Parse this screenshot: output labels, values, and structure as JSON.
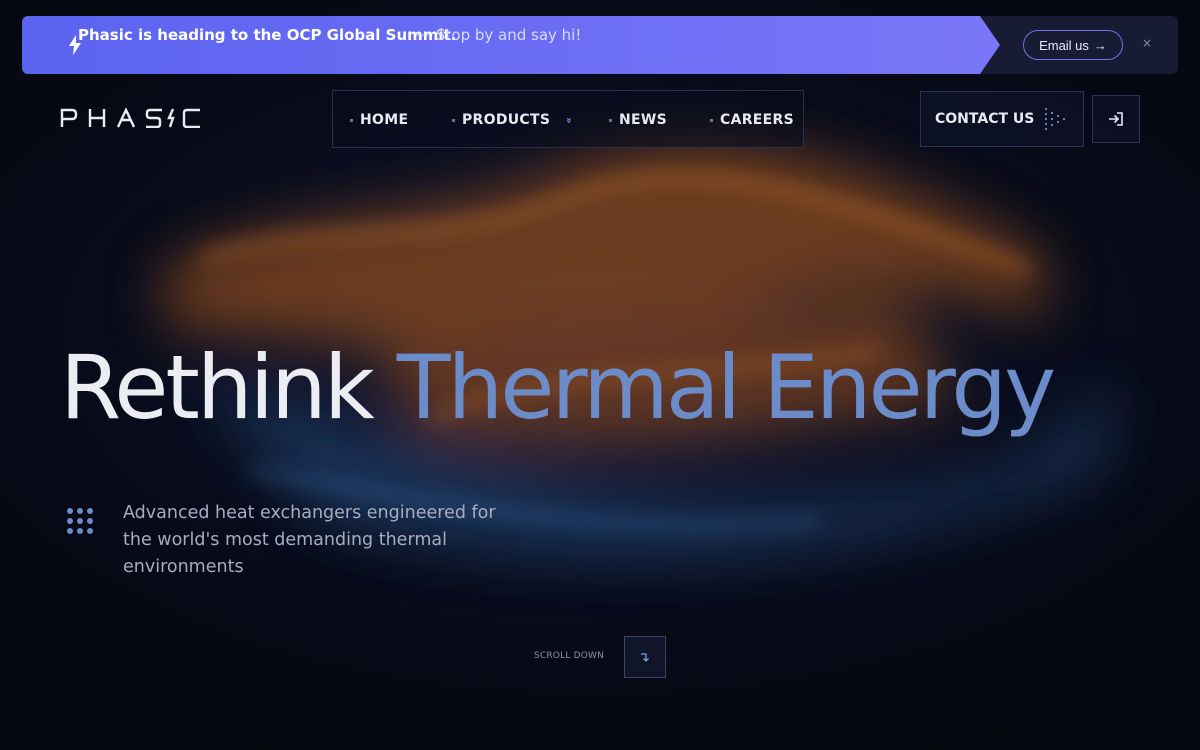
{
  "announcement": {
    "headline": "Phasic is heading to the OCP Global Summit.",
    "separator": "—",
    "message": "Stop by and say hi!",
    "cta_label": "Email us",
    "cta_arrow": "→",
    "close_label": "×"
  },
  "brand": {
    "logo_text": "PHASIC"
  },
  "nav": {
    "items": [
      {
        "label": "HOME"
      },
      {
        "label": "PRODUCTS",
        "has_dropdown": true,
        "dropdown_icon": "»"
      },
      {
        "label": "NEWS"
      },
      {
        "label": "CAREERS"
      }
    ],
    "contact_label": "CONTACT US"
  },
  "hero": {
    "headline_part1": "Rethink",
    "headline_part2": "Thermal Energy",
    "description": "Advanced heat exchangers engineered for the world's most demanding thermal environments"
  },
  "scroll": {
    "label": "SCROLL DOWN"
  },
  "colors": {
    "accent": "#6b8cc8",
    "banner": "#6366f1",
    "background": "#070a17"
  }
}
